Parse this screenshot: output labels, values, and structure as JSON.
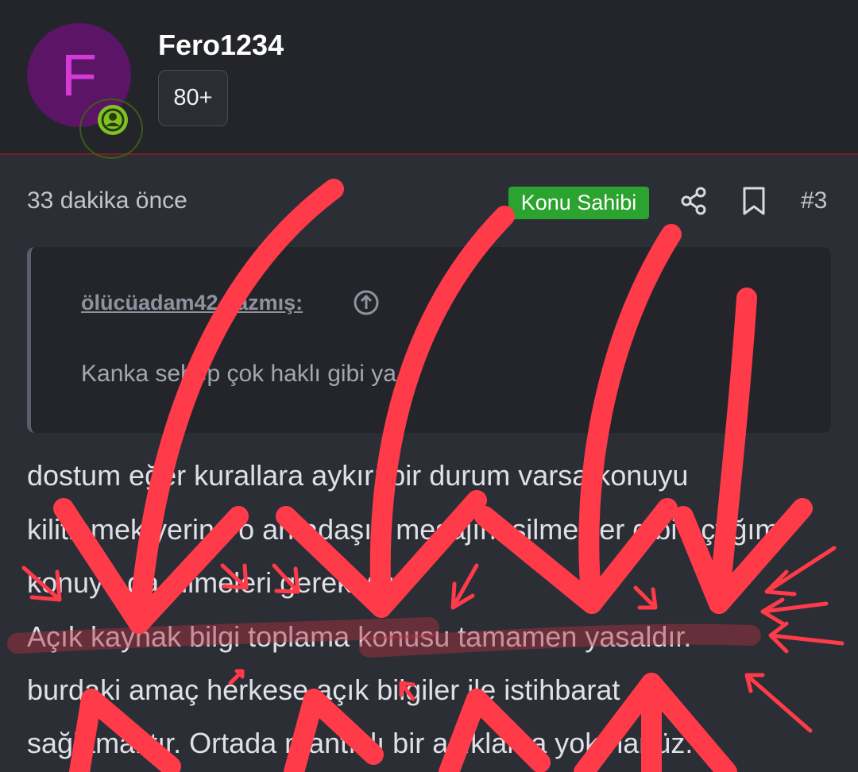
{
  "header": {
    "avatar_letter": "F",
    "username": "Fero1234",
    "reaction_badge": "80+",
    "status_icon": "user-online-icon"
  },
  "post": {
    "timestamp": "33 dakika önce",
    "owner_badge": "Konu Sahibi",
    "post_number": "#3",
    "share_icon": "share-icon",
    "bookmark_icon": "bookmark-icon"
  },
  "quote": {
    "author_line": "ölücüadam42 yazmış:",
    "text": "Kanka sebep çok haklı gibi ya"
  },
  "body": {
    "lines": [
      "dostum eğer kurallara aykırı bir durum varsa konuyu",
      "kilitlemek yerine o arkadaşın mesajını silmekler gibi açtığım",
      "konuyu da silmeleri gerekiyor.",
      "Açık kaynak bilgi toplama konusu tamamen yasaldır.",
      "burdaki amaç herkese açık bilgiler ile istihbarat",
      "sağlamaktır. Ortada mantıklı bir açıklama yok hanüz."
    ]
  },
  "colors": {
    "background": "#2c2e36",
    "header_bg": "#23252b",
    "avatar_bg": "#5c1566",
    "avatar_letter": "#d63ad6",
    "online": "#7fc41e",
    "owner_badge": "#2aa32f",
    "annotation": "#ff3b4a"
  }
}
